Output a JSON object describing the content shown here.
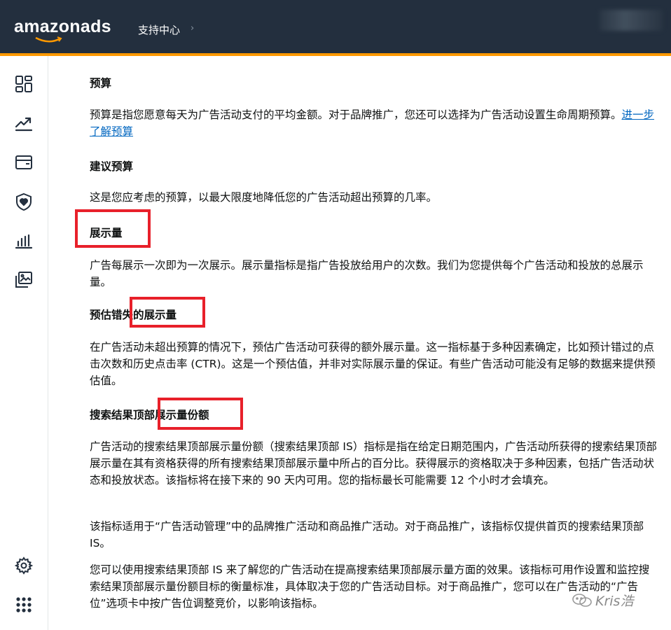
{
  "header": {
    "brand_text": "amazonads",
    "nav_link": "支持中心",
    "nav_chevron": "›",
    "colors": {
      "background": "#232f3e",
      "accent": "#ff9900"
    }
  },
  "sidebar": {
    "items": [
      {
        "icon": "dashboard-grid-icon"
      },
      {
        "icon": "trending-up-icon"
      },
      {
        "icon": "wallet-icon"
      },
      {
        "icon": "shield-heart-icon"
      },
      {
        "icon": "bar-chart-icon"
      },
      {
        "icon": "media-gallery-icon"
      }
    ],
    "bottom_items": [
      {
        "icon": "gear-icon"
      },
      {
        "icon": "apps-grid-icon"
      }
    ]
  },
  "content": {
    "sections": [
      {
        "heading": "预算",
        "paragraphs": [
          "预算是指您愿意每天为广告活动支付的平均金额。对于品牌推广，您还可以选择为广告活动设置生命周期预算。"
        ],
        "link": "进一步了解预算"
      },
      {
        "heading": "建议预算",
        "paragraphs": [
          "这是您应考虑的预算，以最大限度地降低您的广告活动超出预算的几率。"
        ]
      },
      {
        "heading": "展示量",
        "paragraphs": [
          "广告每展示一次即为一次展示。展示量指标是指广告投放给用户的次数。我们为您提供每个广告活动和投放的总展示量。"
        ]
      },
      {
        "heading": "预估错失的展示量",
        "paragraphs": [
          "在广告活动未超出预算的情况下，预估广告活动可获得的额外展示量。这一指标基于多种因素确定，比如预计错过的点击次数和历史点击率 (CTR)。这是一个预估值，并非对实际展示量的保证。有些广告活动可能没有足够的数据来提供预估值。"
        ]
      },
      {
        "heading": "搜索结果顶部展示量份额",
        "paragraphs": [
          "广告活动的搜索结果顶部展示量份额（搜索结果顶部 IS）指标是指在给定日期范围内，广告活动所获得的搜索结果顶部展示量在其有资格获得的所有搜索结果顶部展示量中所占的百分比。获得展示的资格取决于多种因素，包括广告活动状态和投放状态。该指标将在接下来的 90 天内可用。您的指标最长可能需要 12 个小时才会填充。",
          "该指标适用于“广告活动管理”中的品牌推广活动和商品推广活动。对于商品推广，该指标仅提供首页的搜索结果顶部 IS。",
          "您可以使用搜索结果顶部 IS 来了解您的广告活动在提高搜索结果顶部展示量方面的效果。该指标可用作设置和监控搜索结果顶部展示量份额目标的衡量标准，具体取决于您的广告活动目标。对于商品推广，您可以在广告活动的“广告位”选项卡中按广告位调整竞价，以影响该指标。"
        ]
      }
    ]
  },
  "watermark": {
    "text": "Kris浩"
  },
  "annotation_color": "#e8202a"
}
